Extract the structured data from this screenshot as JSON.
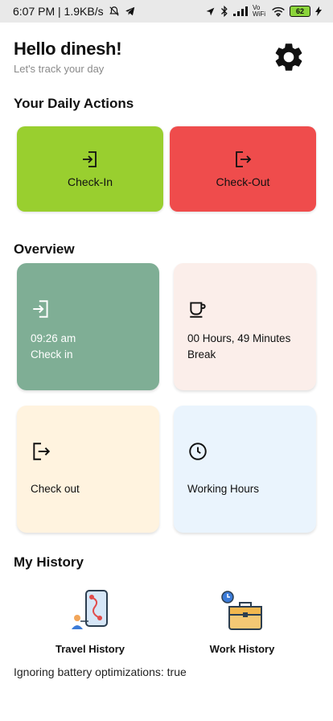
{
  "status_bar": {
    "time_speed": "6:07 PM | 1.9KB/s",
    "network": "Vo WiFi",
    "battery": "62"
  },
  "header": {
    "greeting": "Hello dinesh!",
    "subtitle": "Let's track your day"
  },
  "daily_actions": {
    "title": "Your Daily Actions",
    "check_in_label": "Check-In",
    "check_out_label": "Check-Out",
    "colors": {
      "check_in": "#99cf2f",
      "check_out": "#ef4c4c"
    }
  },
  "overview": {
    "title": "Overview",
    "cards": [
      {
        "line1": "09:26 am",
        "line2": "Check in",
        "icon": "login-icon",
        "bg": "#7fae95"
      },
      {
        "line1": "00 Hours, 49 Minutes",
        "line2": "Break",
        "icon": "coffee-cup-icon",
        "bg": "#fbeeea"
      },
      {
        "line1": "Check out",
        "line2": "",
        "icon": "logout-icon",
        "bg": "#fff3df"
      },
      {
        "line1": "Working Hours",
        "line2": "",
        "icon": "clock-icon",
        "bg": "#eaf4fd"
      }
    ]
  },
  "history": {
    "title": "My History",
    "travel_label": "Travel History",
    "work_label": "Work History"
  },
  "footer": {
    "battery_opt": "Ignoring battery optimizations: true"
  }
}
